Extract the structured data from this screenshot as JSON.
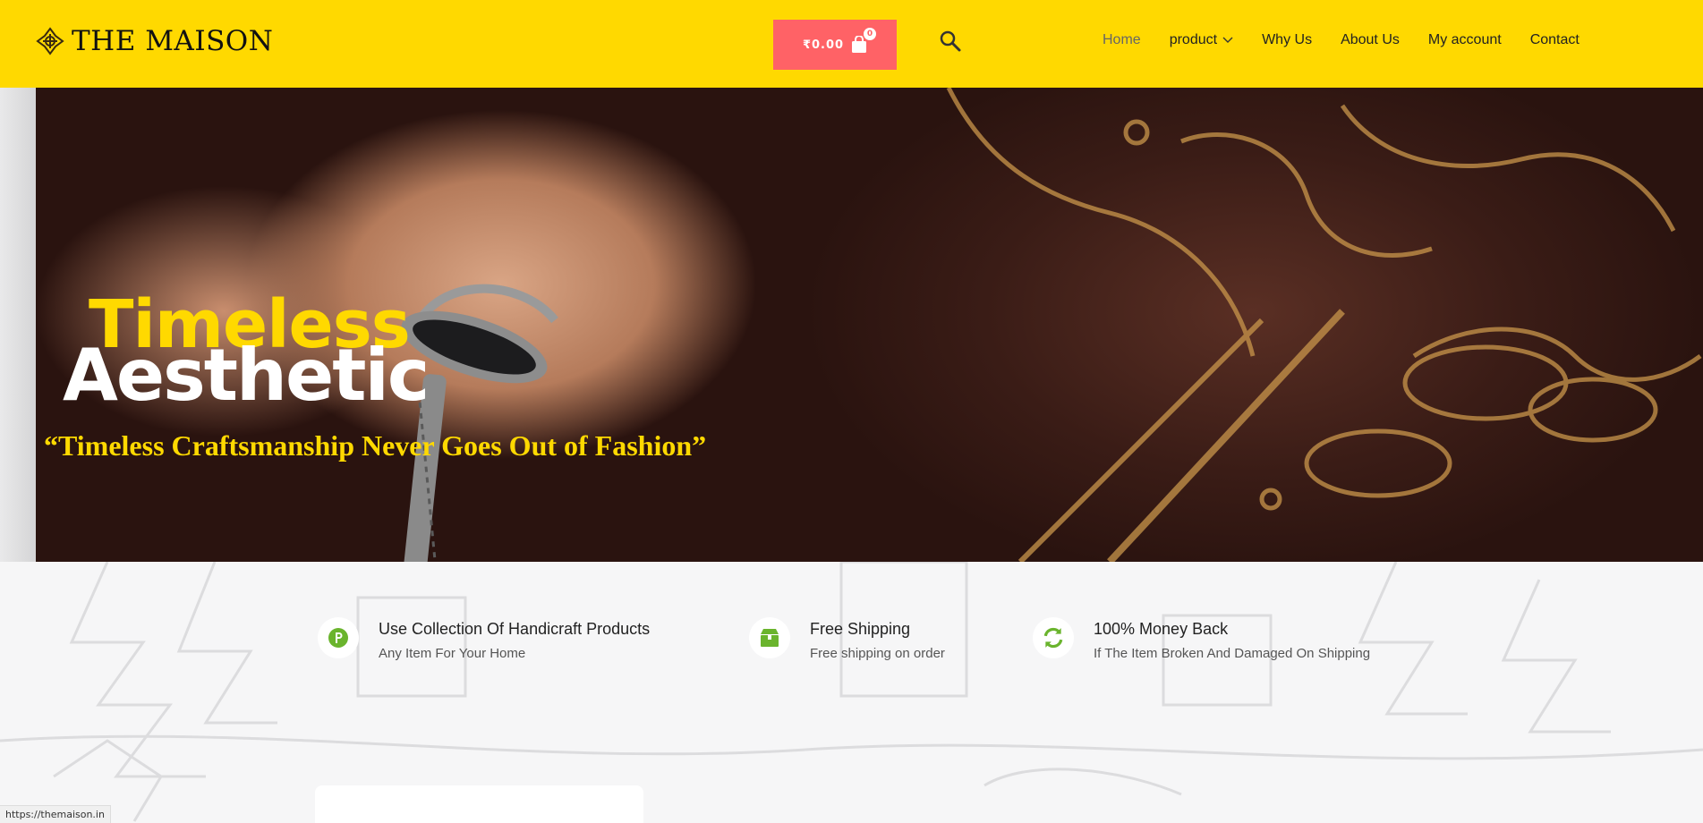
{
  "header": {
    "logo_text": "THE MAISON",
    "cart": {
      "amount": "₹0.00",
      "count": "0"
    },
    "nav": [
      {
        "label": "Home"
      },
      {
        "label": "product"
      },
      {
        "label": "Why Us"
      },
      {
        "label": "About Us"
      },
      {
        "label": "My account"
      },
      {
        "label": "Contact"
      }
    ]
  },
  "hero": {
    "title_line1": "Timeless",
    "title_line2": "Aesthetic",
    "quote": "“Timeless Craftsmanship Never Goes Out of Fashion”"
  },
  "features": [
    {
      "icon": "p-badge-icon",
      "title": "Use Collection Of Handicraft Products",
      "desc": "Any Item For Your Home"
    },
    {
      "icon": "box-icon",
      "title": "Free Shipping",
      "desc": "Free shipping on order"
    },
    {
      "icon": "refresh-icon",
      "title": "100% Money Back",
      "desc": "If The Item Broken And Damaged On Shipping"
    }
  ],
  "status_bar": {
    "url": "https://themaison.in"
  },
  "colors": {
    "header_bg": "#ffd900",
    "cart_bg": "#ff6266",
    "accent_green": "#6ab42d"
  }
}
